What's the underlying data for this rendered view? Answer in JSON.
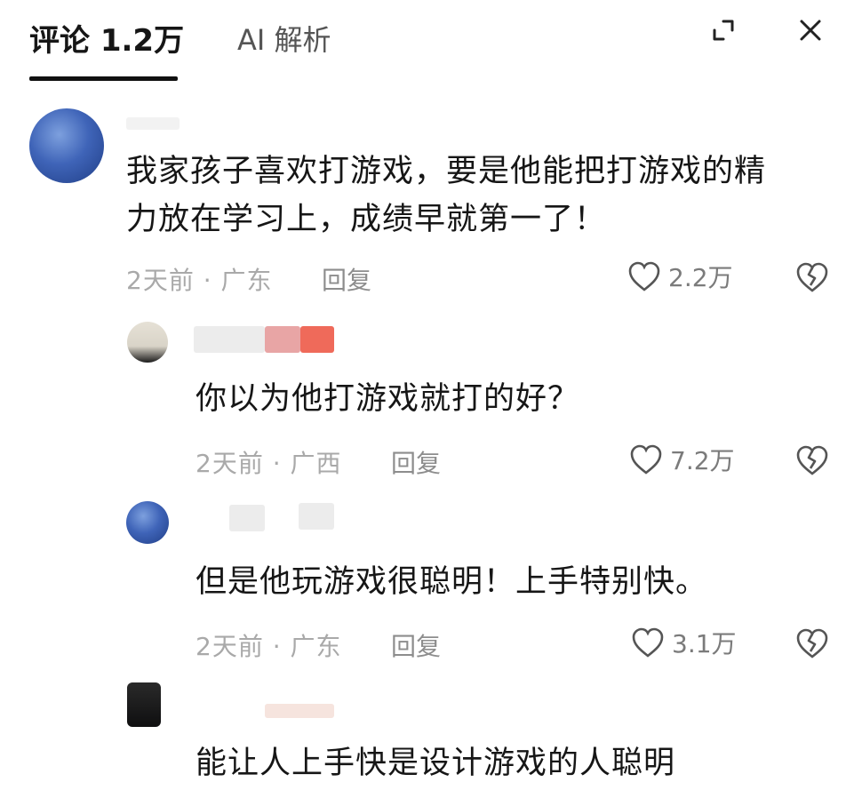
{
  "header": {
    "comments_tab": "评论 1.2万",
    "ai_tab": "AI 解析",
    "expand_icon": "expand-icon",
    "close_icon": "close-icon"
  },
  "comments": [
    {
      "text_line1": "我家孩子喜欢打游戏，要是他能把打游戏的精",
      "text_line2": "力放在学习上，成绩早就第一了！",
      "time_location": "2天前 · 广东",
      "reply_label": "回复",
      "likes": "2.2万"
    },
    {
      "text": "你以为他打游戏就打的好？",
      "time_location": "2天前 · 广西",
      "reply_label": "回复",
      "likes": "7.2万"
    },
    {
      "text": "但是他玩游戏很聪明！上手特别快。",
      "time_location": "2天前 · 广东",
      "reply_label": "回复",
      "likes": "3.1万"
    },
    {
      "text": "能让人上手快是设计游戏的人聪明"
    }
  ],
  "colors": {
    "text_primary": "#161616",
    "text_meta": "#a9a9a9",
    "avatar_blue": "#3f64b8"
  }
}
